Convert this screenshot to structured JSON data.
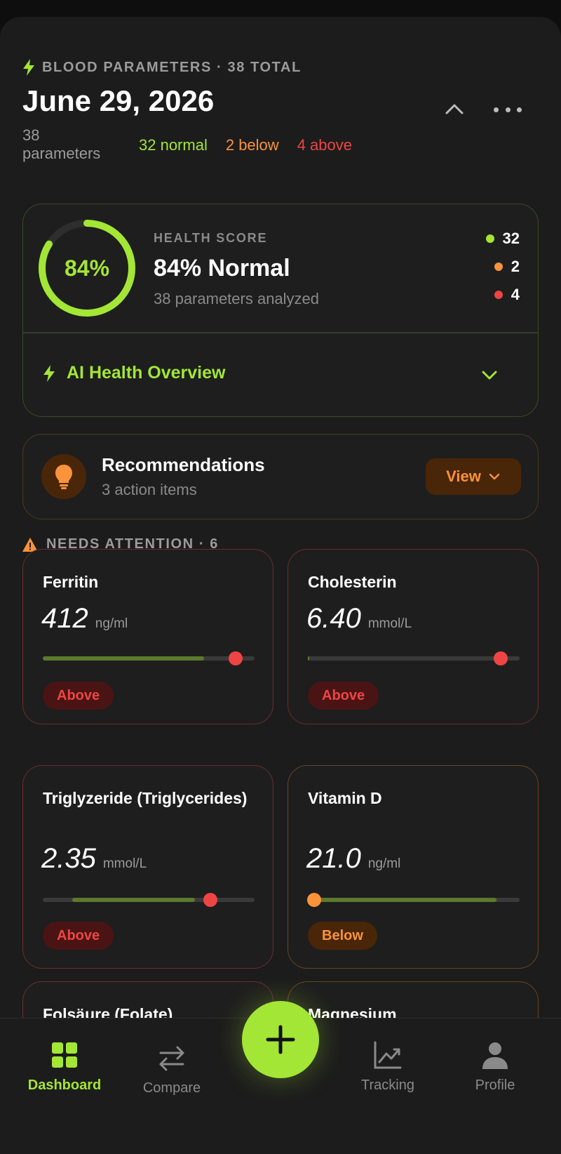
{
  "header": {
    "label": "BLOOD PARAMETERS · 38 TOTAL",
    "date": "June 29, 2026",
    "total_line1": "38",
    "total_line2": "parameters",
    "normal": "32 normal",
    "below": "2 below",
    "above": "4 above"
  },
  "health": {
    "ring_text": "84%",
    "score_fraction": 0.84,
    "label": "HEALTH SCORE",
    "title": "84% Normal",
    "sub": "38 parameters analyzed",
    "legend": {
      "normal": "32",
      "below": "2",
      "above": "4"
    },
    "ai_label": "AI Health Overview"
  },
  "recommendations": {
    "title": "Recommendations",
    "sub": "3 action items",
    "button": "View"
  },
  "attention": {
    "label": "NEEDS ATTENTION · 6",
    "cards": [
      {
        "name": "Ferritin",
        "value": "412",
        "unit": "ng/ml",
        "status": "Above",
        "range": [
          0,
          0.76
        ],
        "marker": 0.91
      },
      {
        "name": "Cholesterin",
        "value": "6.40",
        "unit": "mmol/L",
        "status": "Above",
        "range": [
          0,
          0.005
        ],
        "marker": 0.91
      },
      {
        "name": "Triglyzeride (Triglycerides)",
        "value": "2.35",
        "unit": "mmol/L",
        "status": "Above",
        "range": [
          0.14,
          0.72
        ],
        "marker": 0.79
      },
      {
        "name": "Vitamin D",
        "value": "21.0",
        "unit": "ng/ml",
        "status": "Below",
        "range": [
          0.04,
          0.89
        ],
        "marker": 0.03
      },
      {
        "name": "Folsäure (Folate)"
      },
      {
        "name": "Magnesium"
      }
    ]
  },
  "nav": {
    "dashboard": "Dashboard",
    "compare": "Compare",
    "tracking": "Tracking",
    "profile": "Profile"
  },
  "colors": {
    "accent": "#a3e635",
    "below": "#fb923c",
    "above": "#ef4444"
  }
}
